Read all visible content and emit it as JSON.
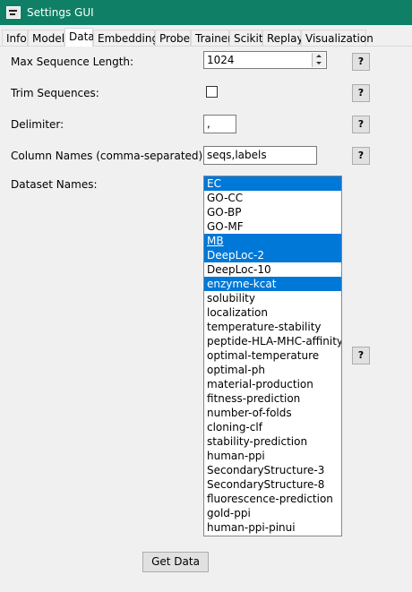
{
  "window": {
    "title": "Settings GUI"
  },
  "tabs": [
    {
      "label": "Info",
      "active": false
    },
    {
      "label": "Model",
      "active": false
    },
    {
      "label": "Data",
      "active": true
    },
    {
      "label": "Embedding",
      "active": false
    },
    {
      "label": "Probe",
      "active": false
    },
    {
      "label": "Trainer",
      "active": false
    },
    {
      "label": "Scikit",
      "active": false
    },
    {
      "label": "Replay",
      "active": false
    },
    {
      "label": "Visualization",
      "active": false
    }
  ],
  "form": {
    "max_seq_len": {
      "label": "Max Sequence Length:",
      "value": "1024"
    },
    "trim": {
      "label": "Trim Sequences:",
      "checked": false
    },
    "delimiter": {
      "label": "Delimiter:",
      "value": ","
    },
    "column_names": {
      "label": "Column Names (comma-separated):",
      "value": "seqs,labels"
    },
    "datasets": {
      "label": "Dataset Names:",
      "items": [
        {
          "label": "EC",
          "selected": true
        },
        {
          "label": "GO-CC",
          "selected": false
        },
        {
          "label": "GO-BP",
          "selected": false
        },
        {
          "label": "GO-MF",
          "selected": false
        },
        {
          "label": "MB",
          "selected": true,
          "focused": true
        },
        {
          "label": "DeepLoc-2",
          "selected": true
        },
        {
          "label": "DeepLoc-10",
          "selected": false
        },
        {
          "label": "enzyme-kcat",
          "selected": true
        },
        {
          "label": "solubility",
          "selected": false
        },
        {
          "label": "localization",
          "selected": false
        },
        {
          "label": "temperature-stability",
          "selected": false
        },
        {
          "label": "peptide-HLA-MHC-affinity",
          "selected": false
        },
        {
          "label": "optimal-temperature",
          "selected": false
        },
        {
          "label": "optimal-ph",
          "selected": false
        },
        {
          "label": "material-production",
          "selected": false
        },
        {
          "label": "fitness-prediction",
          "selected": false
        },
        {
          "label": "number-of-folds",
          "selected": false
        },
        {
          "label": "cloning-clf",
          "selected": false
        },
        {
          "label": "stability-prediction",
          "selected": false
        },
        {
          "label": "human-ppi",
          "selected": false
        },
        {
          "label": "SecondaryStructure-3",
          "selected": false
        },
        {
          "label": "SecondaryStructure-8",
          "selected": false
        },
        {
          "label": "fluorescence-prediction",
          "selected": false
        },
        {
          "label": "gold-ppi",
          "selected": false
        },
        {
          "label": "human-ppi-pinui",
          "selected": false
        }
      ]
    },
    "help_label": "?",
    "get_data_label": "Get Data"
  },
  "colors": {
    "titlebar": "#0f8066",
    "selection": "#0078d7"
  }
}
